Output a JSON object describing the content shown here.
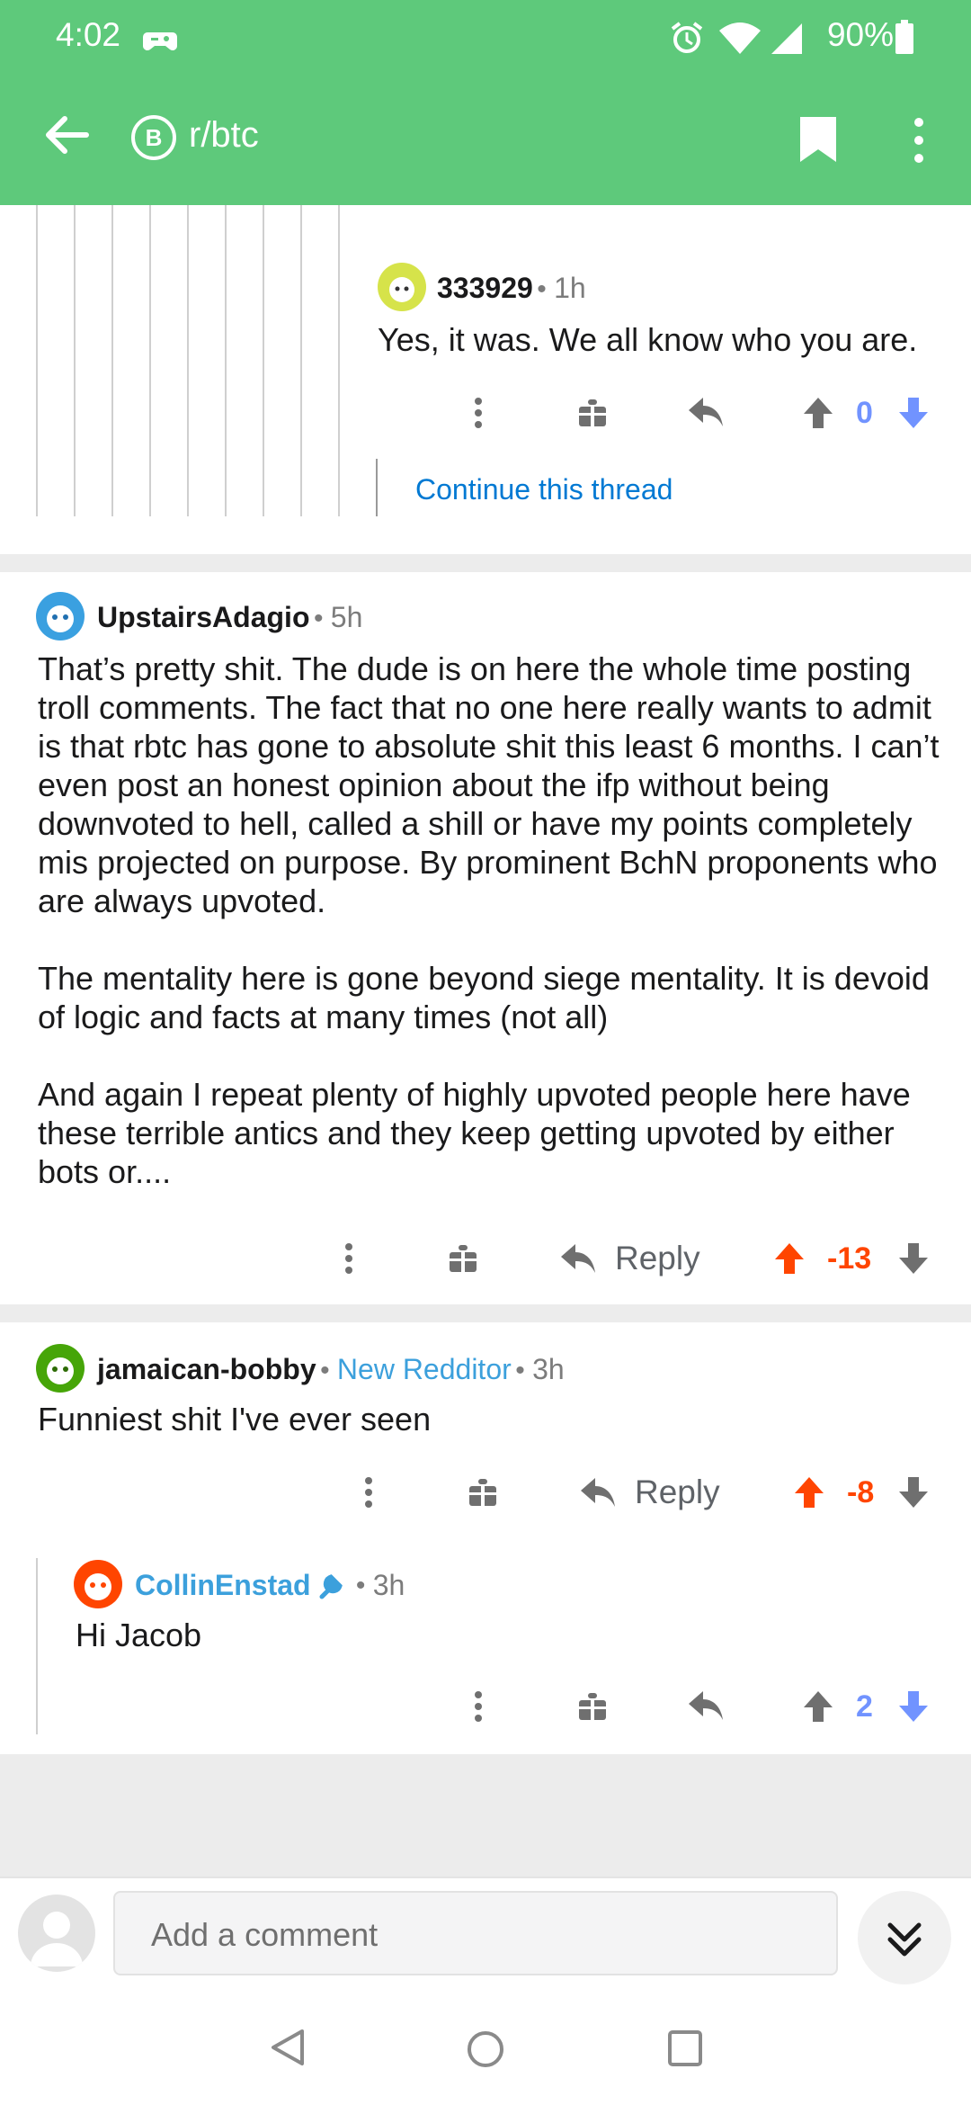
{
  "status_bar": {
    "time": "4:02",
    "battery": "90%"
  },
  "header": {
    "subreddit": "r/btc",
    "sub_icon_letter": "B"
  },
  "colors": {
    "header_bg": "#5ec97b",
    "upvote_orange": "#ff4500",
    "downvote_blue": "#7193ff",
    "link_blue": "#0079d3"
  },
  "comments": {
    "c1": {
      "user": "333929",
      "time": "1h",
      "body": "Yes, it was. We all know who you are.",
      "score": "0",
      "continue_label": "Continue this thread"
    },
    "c2": {
      "user": "UpstairsAdagio",
      "time": "5h",
      "body": "That’s pretty shit. The dude is on here the whole time posting troll comments. The fact that no one here really wants to admit is that rbtc has gone to absolute shit this least 6 months. I can’t even post an honest opinion about the ifp without being downvoted to hell, called a shill or have my points completely mis projected on purpose. By prominent BchN proponents who are always upvoted.\n\nThe mentality here is gone beyond siege mentality. It is devoid of logic and facts at many times (not all)\n\nAnd again I repeat plenty of highly upvoted people here have these terrible antics and they keep getting upvoted by either bots or....",
      "reply_label": "Reply",
      "score": "-13"
    },
    "c3": {
      "user": "jamaican-bobby",
      "flair": "New Redditor",
      "time": "3h",
      "body": "Funniest shit I've ever seen",
      "reply_label": "Reply",
      "score": "-8"
    },
    "c4": {
      "user": "CollinEnstad",
      "time": "3h",
      "body": "Hi Jacob",
      "score": "2"
    }
  },
  "composer": {
    "placeholder": "Add a comment"
  },
  "nav": {
    "icons": [
      "back-triangle-icon",
      "home-circle-icon",
      "recents-square-icon"
    ]
  }
}
